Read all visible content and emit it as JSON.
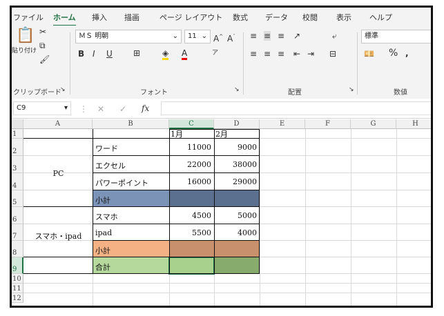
{
  "ribbon": {
    "tabs": [
      "ファイル",
      "ホーム",
      "挿入",
      "描画",
      "ページ レイアウト",
      "数式",
      "データ",
      "校閲",
      "表示",
      "ヘルプ"
    ],
    "active_tab": "ホーム",
    "clipboard": {
      "paste_label": "貼り付け",
      "group_label": "クリップボード"
    },
    "font": {
      "name": "ＭＳ 明朝",
      "size": "11",
      "bold": "B",
      "italic": "I",
      "underline": "U",
      "group_label": "フォント"
    },
    "alignment": {
      "group_label": "配置"
    },
    "number": {
      "format": "標準",
      "group_label": "数値",
      "percent": "%"
    }
  },
  "formula_bar": {
    "name_box": "C9",
    "fx": "fx",
    "formula": ""
  },
  "columns": [
    "A",
    "B",
    "C",
    "D",
    "E",
    "F",
    "G",
    "H"
  ],
  "rows": [
    "1",
    "2",
    "3",
    "4",
    "5",
    "6",
    "7",
    "8",
    "9",
    "10",
    "11",
    "12"
  ],
  "selected_column": "C",
  "selected_row": "9",
  "table": {
    "header": {
      "c": "1月",
      "d": "2月"
    },
    "group_pc": "PC",
    "group_smartphone": "スマホ・ipad",
    "word": {
      "label": "ワード",
      "c": "11000",
      "d": "9000"
    },
    "excel": {
      "label": "エクセル",
      "c": "22000",
      "d": "38000"
    },
    "powerpoint": {
      "label": "パワーポイント",
      "c": "16000",
      "d": "29000"
    },
    "subtotal1": {
      "label": "小計"
    },
    "smartphone": {
      "label": "スマホ",
      "c": "4500",
      "d": "5000"
    },
    "ipad": {
      "label": "ipad",
      "c": "5500",
      "d": "4000"
    },
    "subtotal2": {
      "label": "小計"
    },
    "total": {
      "label": "合計"
    }
  },
  "colors": {
    "subtotal1_label": "#7b93b6",
    "subtotal1_cells": "#5b6f8f",
    "subtotal2_label": "#f4b183",
    "subtotal2_cells": "#c8906c",
    "total_label": "#b5d99c",
    "total_cell_c": "#a9d18e",
    "total_cell_d": "#86ab6d",
    "accent": "#217346"
  }
}
